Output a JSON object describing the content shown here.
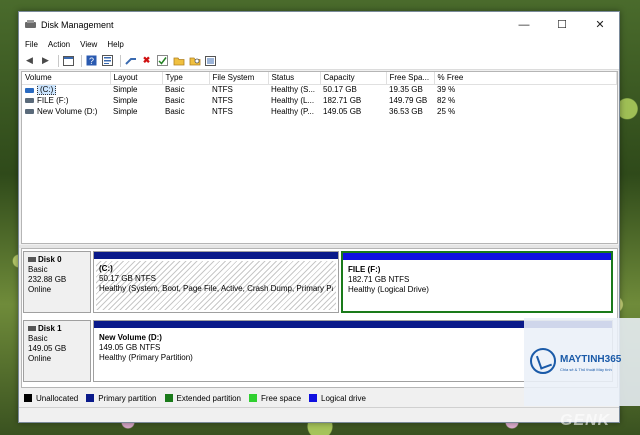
{
  "window": {
    "title": "Disk Management"
  },
  "menu": [
    "File",
    "Action",
    "View",
    "Help"
  ],
  "volume_table": {
    "columns": [
      "Volume",
      "Layout",
      "Type",
      "File System",
      "Status",
      "Capacity",
      "Free Spa...",
      "% Free"
    ],
    "rows": [
      [
        "(C:)",
        "Simple",
        "Basic",
        "NTFS",
        "Healthy (S...",
        "50.17 GB",
        "19.35 GB",
        "39 %"
      ],
      [
        "FILE (F:)",
        "Simple",
        "Basic",
        "NTFS",
        "Healthy (L...",
        "182.71 GB",
        "149.79 GB",
        "82 %"
      ],
      [
        "New Volume (D:)",
        "Simple",
        "Basic",
        "NTFS",
        "Healthy (P...",
        "149.05 GB",
        "36.53 GB",
        "25 %"
      ]
    ]
  },
  "disks": [
    {
      "name": "Disk 0",
      "type": "Basic",
      "size": "232.88 GB",
      "state": "Online",
      "partitions": [
        {
          "name": "(C:)",
          "size": "50.17 GB NTFS",
          "status": "Healthy (System, Boot, Page File, Active, Crash Dump, Primary Pa"
        },
        {
          "name": "FILE  (F:)",
          "size": "182.71 GB NTFS",
          "status": "Healthy (Logical Drive)"
        }
      ]
    },
    {
      "name": "Disk 1",
      "type": "Basic",
      "size": "149.05 GB",
      "state": "Online",
      "partitions": [
        {
          "name": "New Volume  (D:)",
          "size": "149.05 GB NTFS",
          "status": "Healthy (Primary Partition)"
        }
      ]
    }
  ],
  "legend": [
    {
      "label": "Unallocated",
      "color": "#000000"
    },
    {
      "label": "Primary partition",
      "color": "#0a1a8a"
    },
    {
      "label": "Extended partition",
      "color": "#1a7a1a"
    },
    {
      "label": "Free space",
      "color": "#30d030"
    },
    {
      "label": "Logical drive",
      "color": "#1010e0"
    }
  ],
  "watermark": {
    "brand": "MAYTINH365",
    "tagline": "Chia sẻ & Thủ thuật Máy tính",
    "site": "GENK"
  }
}
